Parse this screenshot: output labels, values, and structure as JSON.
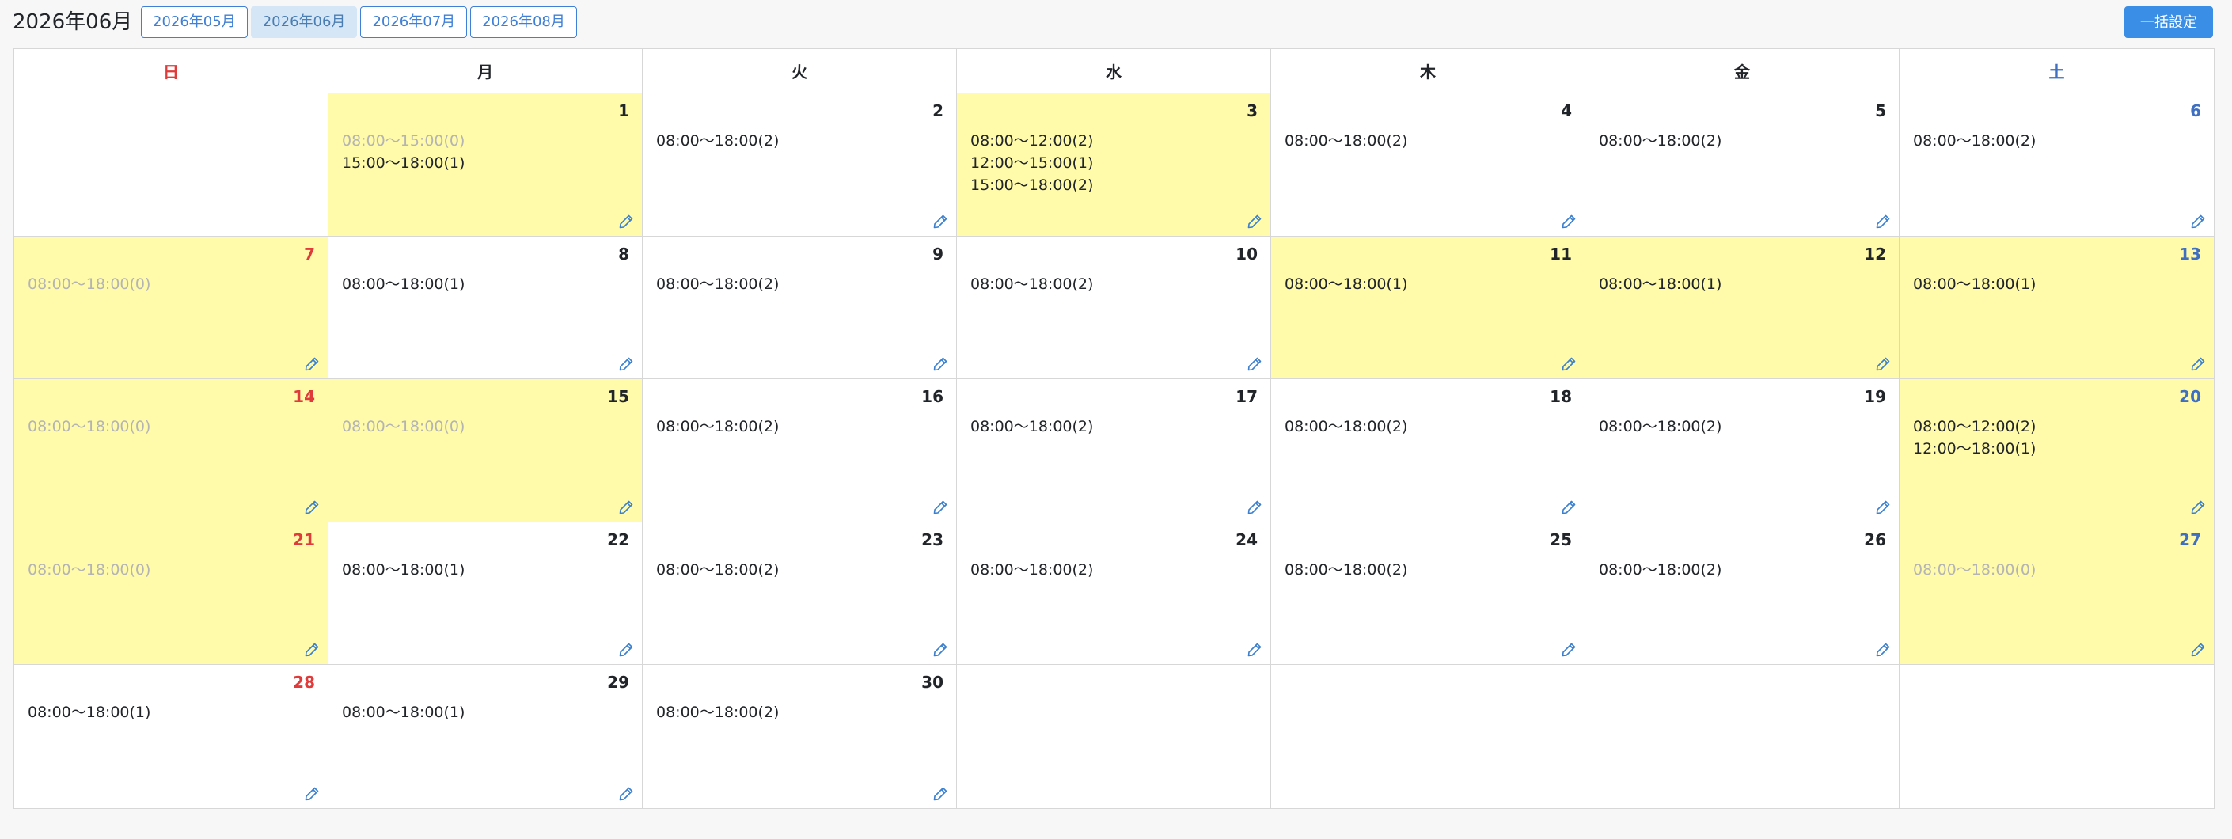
{
  "header": {
    "title": "2026年06月",
    "month_tabs": [
      "2026年05月",
      "2026年06月",
      "2026年07月",
      "2026年08月"
    ],
    "active_tab": "2026年06月",
    "bulk_button": "一括設定"
  },
  "weekdays": [
    "日",
    "月",
    "火",
    "水",
    "木",
    "金",
    "土"
  ],
  "colors": {
    "sunday": "#e03b3b",
    "saturday": "#3f6fc0",
    "highlight": "#fffbaa",
    "accent": "#3a8ee6",
    "zero_slot": "#b4b4b4"
  },
  "icons": {
    "edit": "pencil-icon"
  },
  "days": [
    {
      "day": "1",
      "highlighted": true,
      "slots": [
        {
          "text": "08:00〜15:00(0)",
          "available": false
        },
        {
          "text": "15:00〜18:00(1)",
          "available": true
        }
      ]
    },
    {
      "day": "2",
      "highlighted": false,
      "slots": [
        {
          "text": "08:00〜18:00(2)",
          "available": true
        }
      ]
    },
    {
      "day": "3",
      "highlighted": true,
      "slots": [
        {
          "text": "08:00〜12:00(2)",
          "available": true
        },
        {
          "text": "12:00〜15:00(1)",
          "available": true
        },
        {
          "text": "15:00〜18:00(2)",
          "available": true
        }
      ]
    },
    {
      "day": "4",
      "highlighted": false,
      "slots": [
        {
          "text": "08:00〜18:00(2)",
          "available": true
        }
      ]
    },
    {
      "day": "5",
      "highlighted": false,
      "slots": [
        {
          "text": "08:00〜18:00(2)",
          "available": true
        }
      ]
    },
    {
      "day": "6",
      "highlighted": false,
      "slots": [
        {
          "text": "08:00〜18:00(2)",
          "available": true
        }
      ]
    },
    {
      "day": "7",
      "highlighted": true,
      "slots": [
        {
          "text": "08:00〜18:00(0)",
          "available": false
        }
      ]
    },
    {
      "day": "8",
      "highlighted": false,
      "slots": [
        {
          "text": "08:00〜18:00(1)",
          "available": true
        }
      ]
    },
    {
      "day": "9",
      "highlighted": false,
      "slots": [
        {
          "text": "08:00〜18:00(2)",
          "available": true
        }
      ]
    },
    {
      "day": "10",
      "highlighted": false,
      "slots": [
        {
          "text": "08:00〜18:00(2)",
          "available": true
        }
      ]
    },
    {
      "day": "11",
      "highlighted": true,
      "slots": [
        {
          "text": "08:00〜18:00(1)",
          "available": true
        }
      ]
    },
    {
      "day": "12",
      "highlighted": true,
      "slots": [
        {
          "text": "08:00〜18:00(1)",
          "available": true
        }
      ]
    },
    {
      "day": "13",
      "highlighted": true,
      "slots": [
        {
          "text": "08:00〜18:00(1)",
          "available": true
        }
      ]
    },
    {
      "day": "14",
      "highlighted": true,
      "slots": [
        {
          "text": "08:00〜18:00(0)",
          "available": false
        }
      ]
    },
    {
      "day": "15",
      "highlighted": true,
      "slots": [
        {
          "text": "08:00〜18:00(0)",
          "available": false
        }
      ]
    },
    {
      "day": "16",
      "highlighted": false,
      "slots": [
        {
          "text": "08:00〜18:00(2)",
          "available": true
        }
      ]
    },
    {
      "day": "17",
      "highlighted": false,
      "slots": [
        {
          "text": "08:00〜18:00(2)",
          "available": true
        }
      ]
    },
    {
      "day": "18",
      "highlighted": false,
      "slots": [
        {
          "text": "08:00〜18:00(2)",
          "available": true
        }
      ]
    },
    {
      "day": "19",
      "highlighted": false,
      "slots": [
        {
          "text": "08:00〜18:00(2)",
          "available": true
        }
      ]
    },
    {
      "day": "20",
      "highlighted": true,
      "slots": [
        {
          "text": "08:00〜12:00(2)",
          "available": true
        },
        {
          "text": "12:00〜18:00(1)",
          "available": true
        }
      ]
    },
    {
      "day": "21",
      "highlighted": true,
      "slots": [
        {
          "text": "08:00〜18:00(0)",
          "available": false
        }
      ]
    },
    {
      "day": "22",
      "highlighted": false,
      "slots": [
        {
          "text": "08:00〜18:00(1)",
          "available": true
        }
      ]
    },
    {
      "day": "23",
      "highlighted": false,
      "slots": [
        {
          "text": "08:00〜18:00(2)",
          "available": true
        }
      ]
    },
    {
      "day": "24",
      "highlighted": false,
      "slots": [
        {
          "text": "08:00〜18:00(2)",
          "available": true
        }
      ]
    },
    {
      "day": "25",
      "highlighted": false,
      "slots": [
        {
          "text": "08:00〜18:00(2)",
          "available": true
        }
      ]
    },
    {
      "day": "26",
      "highlighted": false,
      "slots": [
        {
          "text": "08:00〜18:00(2)",
          "available": true
        }
      ]
    },
    {
      "day": "27",
      "highlighted": true,
      "slots": [
        {
          "text": "08:00〜18:00(0)",
          "available": false
        }
      ]
    },
    {
      "day": "28",
      "highlighted": false,
      "slots": [
        {
          "text": "08:00〜18:00(1)",
          "available": true
        }
      ]
    },
    {
      "day": "29",
      "highlighted": false,
      "slots": [
        {
          "text": "08:00〜18:00(1)",
          "available": true
        }
      ]
    },
    {
      "day": "30",
      "highlighted": false,
      "slots": [
        {
          "text": "08:00〜18:00(2)",
          "available": true
        }
      ]
    }
  ]
}
